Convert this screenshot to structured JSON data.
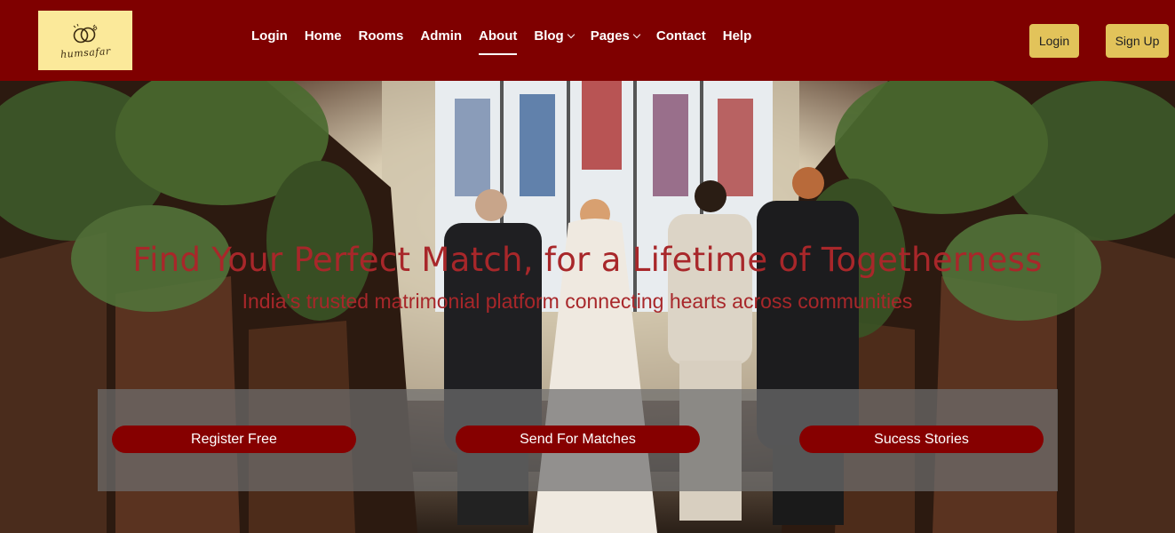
{
  "header": {
    "logo_text": "humsafar",
    "nav": [
      {
        "label": "Login"
      },
      {
        "label": "Home"
      },
      {
        "label": "Rooms"
      },
      {
        "label": "Admin"
      },
      {
        "label": "About",
        "active": true
      },
      {
        "label": "Blog",
        "dropdown": true
      },
      {
        "label": "Pages",
        "dropdown": true
      },
      {
        "label": "Contact"
      },
      {
        "label": "Help"
      }
    ],
    "login_button": "Login",
    "signup_button": "Sign Up"
  },
  "hero": {
    "headline": "Find Your Perfect Match, for a Lifetime of Togetherness",
    "subline": "India's trusted matrimonial platform connecting hearts across communities",
    "buttons": {
      "register": "Register Free",
      "matches": "Send For Matches",
      "stories": "Sucess Stories"
    }
  },
  "colors": {
    "header_bg": "#7f0000",
    "accent_gold": "#e2c35a",
    "logo_bg": "#fbe99a",
    "cta_bg": "#860000",
    "headline": "#a8272a"
  }
}
